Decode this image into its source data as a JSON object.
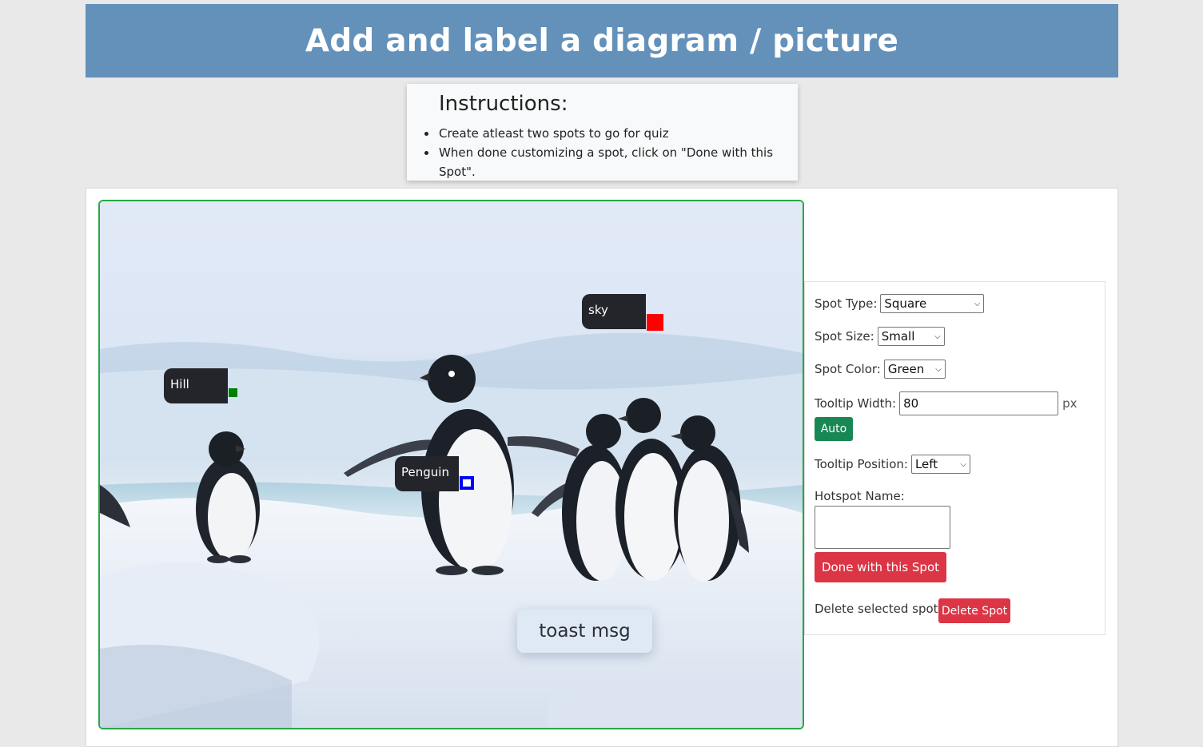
{
  "header": {
    "title": "Add and label a diagram / picture"
  },
  "instructions": {
    "title": "Instructions:",
    "items": [
      "Create atleast two spots to go for quiz",
      "When done customizing a spot, click on \"Done with this Spot\"."
    ]
  },
  "canvas": {
    "image_description_icon": "penguins-on-ice-image",
    "spots": [
      {
        "label": "sky",
        "color": "#ff0000",
        "type": "Square"
      },
      {
        "label": "Hill",
        "color": "#008000",
        "type": "Square"
      },
      {
        "label": "Penguin",
        "color": "#0000ff",
        "type": "Square-outline"
      }
    ],
    "toast": "toast msg"
  },
  "panel": {
    "spot_type_label": "Spot Type:",
    "spot_type_value": "Square",
    "spot_size_label": "Spot Size:",
    "spot_size_value": "Small",
    "spot_color_label": "Spot Color:",
    "spot_color_value": "Green",
    "tooltip_width_label": "Tooltip Width:",
    "tooltip_width_value": "80",
    "tooltip_width_unit": "px",
    "auto_button": "Auto",
    "tooltip_position_label": "Tooltip Position:",
    "tooltip_position_value": "Left",
    "hotspot_name_label": "Hotspot Name:",
    "hotspot_name_value": "",
    "done_button": "Done with this Spot",
    "delete_label": "Delete selected spot?",
    "delete_button": "Delete Spot"
  },
  "colors": {
    "header_bg": "#6391ba",
    "frame_border": "#28a745",
    "auto_button": "#198754",
    "danger_button": "#dc3545"
  }
}
